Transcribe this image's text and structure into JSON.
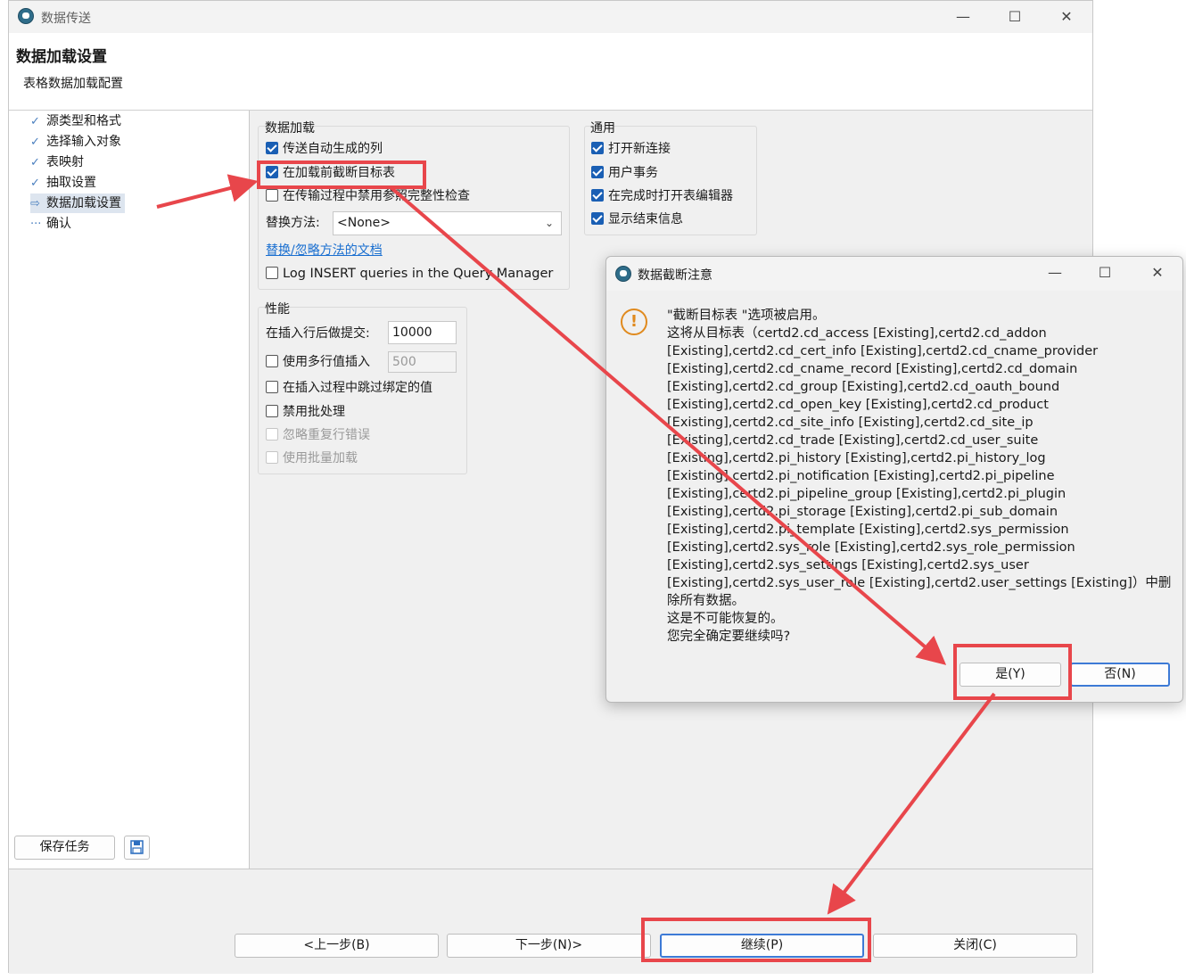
{
  "window": {
    "title": "数据传送",
    "controls": {
      "minimize": "—",
      "maximize": "☐",
      "close": "✕"
    }
  },
  "header": {
    "title": "数据加载设置",
    "subtitle": "表格数据加载配置"
  },
  "steps": [
    {
      "label": "源类型和格式",
      "icon": "check-icon",
      "glyph": "✓"
    },
    {
      "label": "选择输入对象",
      "icon": "check-icon",
      "glyph": "✓"
    },
    {
      "label": "表映射",
      "icon": "check-icon",
      "glyph": "✓"
    },
    {
      "label": "抽取设置",
      "icon": "check-icon",
      "glyph": "✓"
    },
    {
      "label": "数据加载设置",
      "icon": "arrow-right-icon",
      "glyph": "⇨"
    },
    {
      "label": "确认",
      "icon": "dots-icon",
      "glyph": "···"
    }
  ],
  "left_footer": {
    "save_task": "保存任务",
    "save_icon": "save-task-icon"
  },
  "data_load": {
    "title": "数据加载",
    "opt_autogen": "传送自动生成的列",
    "opt_truncate": "在加载前截断目标表",
    "opt_disable_ref": "在传输过程中禁用参照完整性检查",
    "replace_label": "替换方法:",
    "replace_value": "<None>",
    "replace_doc_link": "替换/忽略方法的文档",
    "opt_log_insert": "Log INSERT queries in the Query Manager"
  },
  "general": {
    "title": "通用",
    "opt_open_conn": "打开新连接",
    "opt_user_tx": "用户事务",
    "opt_open_editor": "在完成时打开表编辑器",
    "opt_show_finish": "显示结束信息"
  },
  "performance": {
    "title": "性能",
    "commit_label": "在插入行后做提交:",
    "commit_value": "10000",
    "multi_insert_label": "使用多行值插入",
    "multi_insert_value": "500",
    "skip_bound": "在插入过程中跳过绑定的值",
    "disable_batch": "禁用批处理",
    "ignore_dup": "忽略重复行错误",
    "bulk_load": "使用批量加载"
  },
  "footer": {
    "prev": "<上一步(B)",
    "next": "下一步(N)>",
    "continue": "继续(P)",
    "close": "关闭(C)"
  },
  "dialog": {
    "title": "数据截断注意",
    "icon": "warning-icon",
    "lines": [
      "\"截断目标表 \"选项被启用。",
      "这将从目标表（certd2.cd_access [Existing],certd2.cd_addon",
      "[Existing],certd2.cd_cert_info [Existing],certd2.cd_cname_provider",
      "[Existing],certd2.cd_cname_record [Existing],certd2.cd_domain",
      "[Existing],certd2.cd_group [Existing],certd2.cd_oauth_bound",
      "[Existing],certd2.cd_open_key [Existing],certd2.cd_product",
      "[Existing],certd2.cd_site_info [Existing],certd2.cd_site_ip",
      "[Existing],certd2.cd_trade [Existing],certd2.cd_user_suite",
      "[Existing],certd2.pi_history [Existing],certd2.pi_history_log",
      "[Existing],certd2.pi_notification [Existing],certd2.pi_pipeline",
      "[Existing],certd2.pi_pipeline_group [Existing],certd2.pi_plugin",
      "[Existing],certd2.pi_storage [Existing],certd2.pi_sub_domain",
      "[Existing],certd2.pi_template [Existing],certd2.sys_permission",
      "[Existing],certd2.sys_role [Existing],certd2.sys_role_permission",
      "[Existing],certd2.sys_settings [Existing],certd2.sys_user",
      "[Existing],certd2.sys_user_role [Existing],certd2.user_settings [Existing]）中删",
      "除所有数据。",
      "这是不可能恢复的。",
      "您完全确定要继续吗?"
    ],
    "yes": "是(Y)",
    "no": "否(N)"
  },
  "annotation": {
    "color": "#e8464b"
  }
}
